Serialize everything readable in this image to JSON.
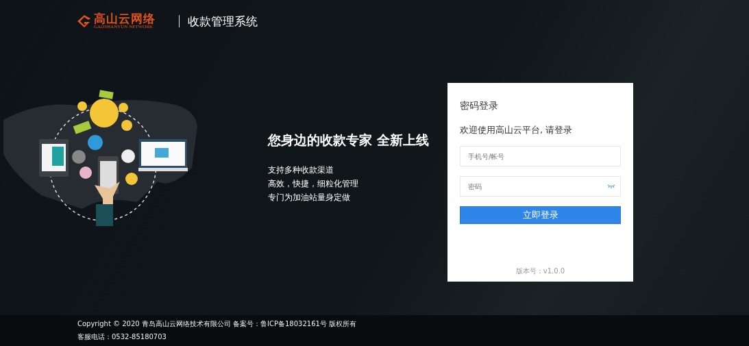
{
  "header": {
    "logo_text": "高山云网络",
    "logo_subtext": "GAOSHANYUN NETWORK",
    "system_title": "收款管理系统"
  },
  "promo": {
    "headline": "您身边的收款专家 全新上线",
    "features": [
      "支持多种收款渠道",
      "高效，快捷，细粒化管理",
      "专门为加油站量身定做"
    ]
  },
  "login": {
    "title": "密码登录",
    "welcome": "欢迎使用高山云平台, 请登录",
    "fields": [
      {
        "kind": "text",
        "placeholder": "手机号/帐号"
      },
      {
        "kind": "password",
        "placeholder": "密码"
      }
    ],
    "submit": "立即登录",
    "version": "版本号：v1.0.0"
  },
  "footer": {
    "lines": [
      "Copyright © 2020 青岛高山云网络技术有限公司 备案号：鲁ICP备18032161号 版权所有",
      "客服电话：0532-85180703"
    ]
  }
}
